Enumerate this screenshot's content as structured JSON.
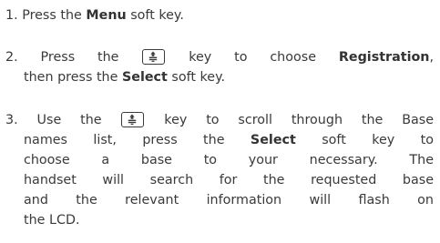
{
  "steps": [
    {
      "number": "1.",
      "pre": "Press the ",
      "bold": "Menu",
      "post": " soft key."
    },
    {
      "number": "2.",
      "line1_pre": "Press the ",
      "key_icon": "up-down-navigation-key-icon",
      "line1_mid": " key to choose ",
      "line1_bold": "Registration",
      "line1_post": ",",
      "line2_pre": "then press the ",
      "line2_bold": "Select",
      "line2_post": " soft key."
    },
    {
      "number": "3.",
      "line1_pre": "Use the ",
      "key_icon": "up-down-navigation-key-icon",
      "line1_post": " key to scroll through the Base",
      "line2_pre": "names list, press the ",
      "line2_bold": "Select",
      "line2_post": " soft key to",
      "line3": "choose a base to your necessary. The",
      "line4": "handset will search for the requested base",
      "line5": "and the relevant information will flash on",
      "line6": "the LCD."
    }
  ]
}
